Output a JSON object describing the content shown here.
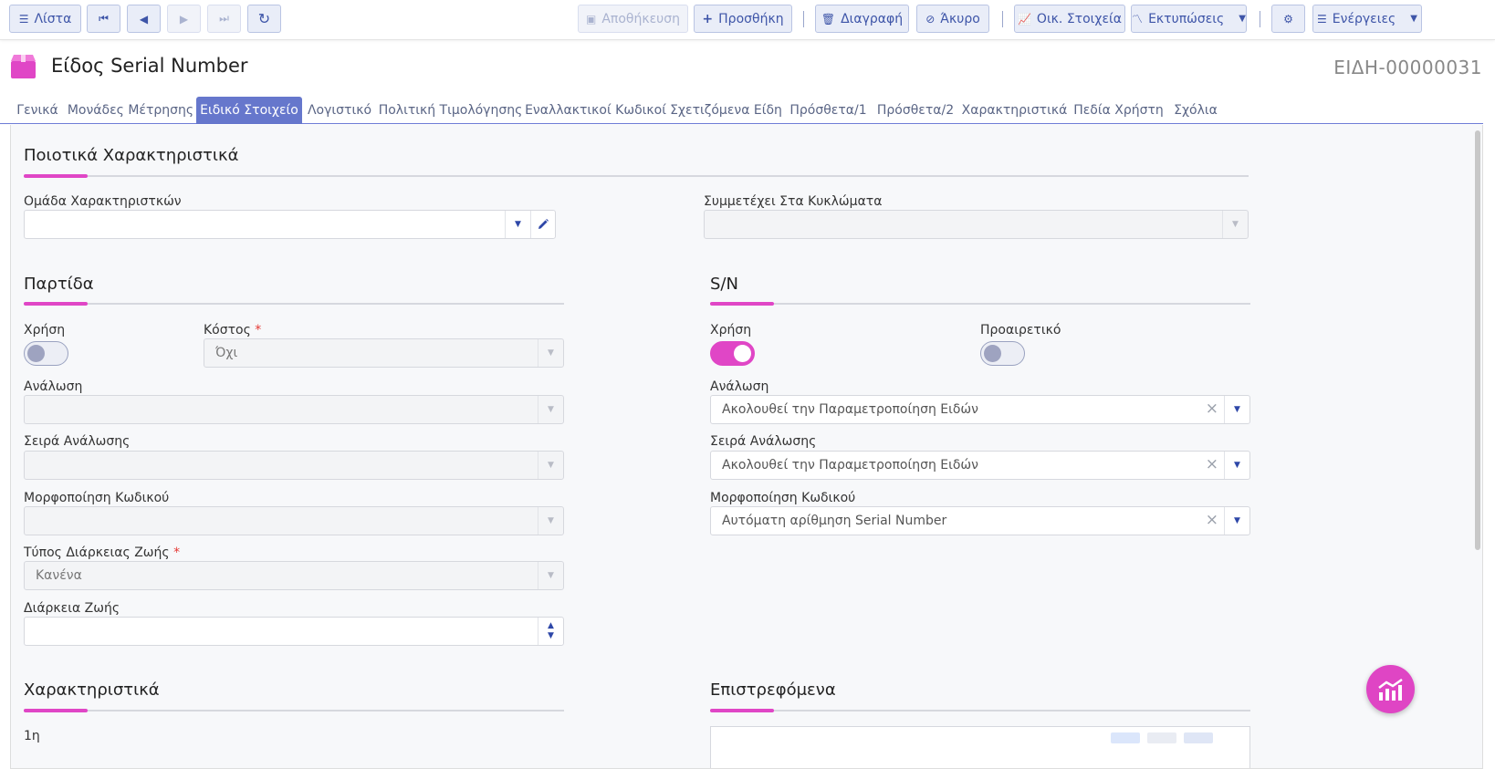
{
  "toolbar": {
    "list": "Λίστα",
    "save": "Αποθήκευση",
    "add": "Προσθήκη",
    "delete": "Διαγραφή",
    "cancel": "Άκυρο",
    "financial": "Οικ. Στοιχεία",
    "prints": "Εκτυπώσεις",
    "actions": "Ενέργειες"
  },
  "header": {
    "title": "Είδος Serial Number",
    "record_id": "ΕΙΔΗ-00000031"
  },
  "tabs": [
    "Γενικά",
    "Μονάδες Μέτρησης",
    "Ειδικό Στοιχείο",
    "Λογιστικό",
    "Πολιτική Τιμολόγησης",
    "Εναλλακτικοί Κωδικοί",
    "Σχετιζόμενα Είδη",
    "Πρόσθετα/1",
    "Πρόσθετα/2",
    "Χαρακτηριστικά",
    "Πεδία Χρήστη",
    "Σχόλια"
  ],
  "quality": {
    "title": "Ποιοτικά Χαρακτηριστικά",
    "group_label": "Ομάδα Χαρακτηριστκών",
    "group_value": "",
    "circuits_label": "Συμμετέχει Στα Κυκλώματα",
    "circuits_value": ""
  },
  "batch": {
    "title": "Παρτίδα",
    "use_label": "Χρήση",
    "use_on": false,
    "cost_label": "Κόστος",
    "cost_value": "Όχι",
    "consumption_label": "Ανάλωση",
    "consumption_value": "",
    "order_label": "Σειρά Ανάλωσης",
    "order_value": "",
    "format_label": "Μορφοποίηση Κωδικού",
    "format_value": "",
    "life_type_label": "Τύπος Διάρκειας Ζωής",
    "life_type_value": "Κανένα",
    "life_label": "Διάρκεια Ζωής",
    "life_value": ""
  },
  "sn": {
    "title": "S/N",
    "use_label": "Χρήση",
    "use_on": true,
    "optional_label": "Προαιρετικό",
    "optional_on": false,
    "consumption_label": "Ανάλωση",
    "consumption_value": "Ακολουθεί την Παραμετροποίηση Ειδών",
    "order_label": "Σειρά Ανάλωσης",
    "order_value": "Ακολουθεί την Παραμετροποίηση Ειδών",
    "format_label": "Μορφοποίηση Κωδικού",
    "format_value": "Αυτόματη αρίθμηση Serial  Number"
  },
  "features": {
    "title": "Χαρακτηριστικά",
    "first_row": "1η"
  },
  "returnables": {
    "title": "Επιστρεφόμενα"
  },
  "colors": {
    "accent": "#e046c6",
    "tab_active": "#6677cc",
    "toolbar_text": "#3e55a8"
  }
}
